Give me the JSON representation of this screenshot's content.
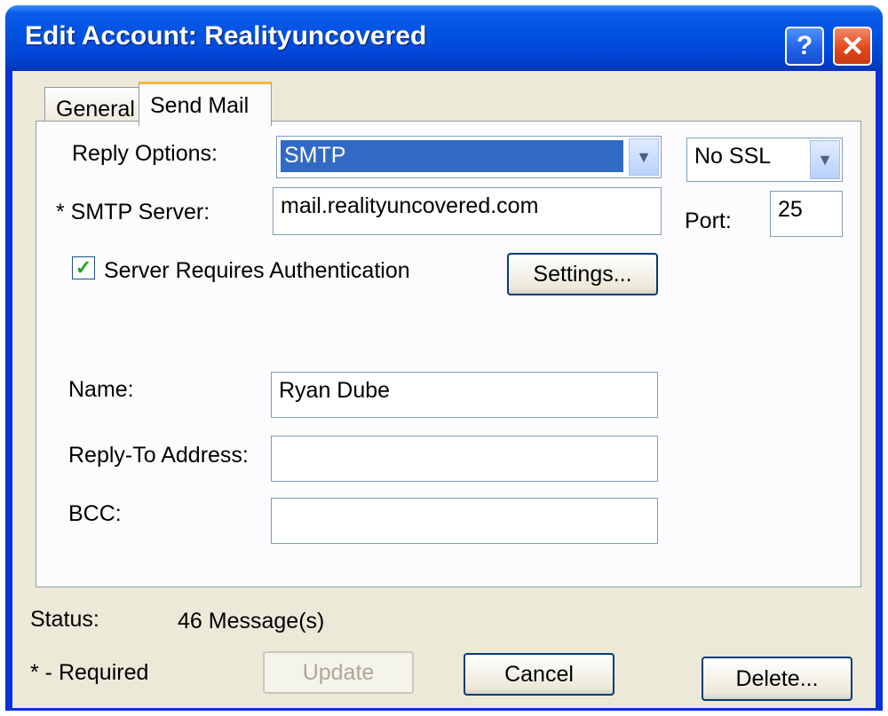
{
  "window": {
    "title": "Edit Account: Realityuncovered",
    "help_glyph": "?",
    "close_glyph": "✕"
  },
  "tabs": [
    {
      "label": "General",
      "selected": false
    },
    {
      "label": "Send Mail",
      "selected": true
    }
  ],
  "send_mail": {
    "reply_options_label": "Reply Options:",
    "reply_options_value": "SMTP",
    "ssl_value": "No SSL",
    "smtp_server_label": "* SMTP Server:",
    "smtp_server_value": "mail.realityuncovered.com",
    "port_label": "Port:",
    "port_value": "25",
    "auth_label": "Server Requires Authentication",
    "auth_checked": true,
    "settings_button": "Settings...",
    "name_label": "Name:",
    "name_value": "Ryan Dube",
    "reply_to_label": "Reply-To Address:",
    "reply_to_value": "",
    "bcc_label": "BCC:",
    "bcc_value": ""
  },
  "footer": {
    "status_label": "Status:",
    "status_value": "46 Message(s)",
    "required_note": "* - Required",
    "update_button": "Update",
    "cancel_button": "Cancel",
    "delete_button": "Delete..."
  },
  "icons": {
    "dropdown": "chevron-down-icon",
    "check": "checkmark-icon"
  },
  "colors": {
    "titlebar": "#0052e0",
    "selection": "#316ac5",
    "client_bg": "#ece9d8",
    "check": "#21a121"
  }
}
